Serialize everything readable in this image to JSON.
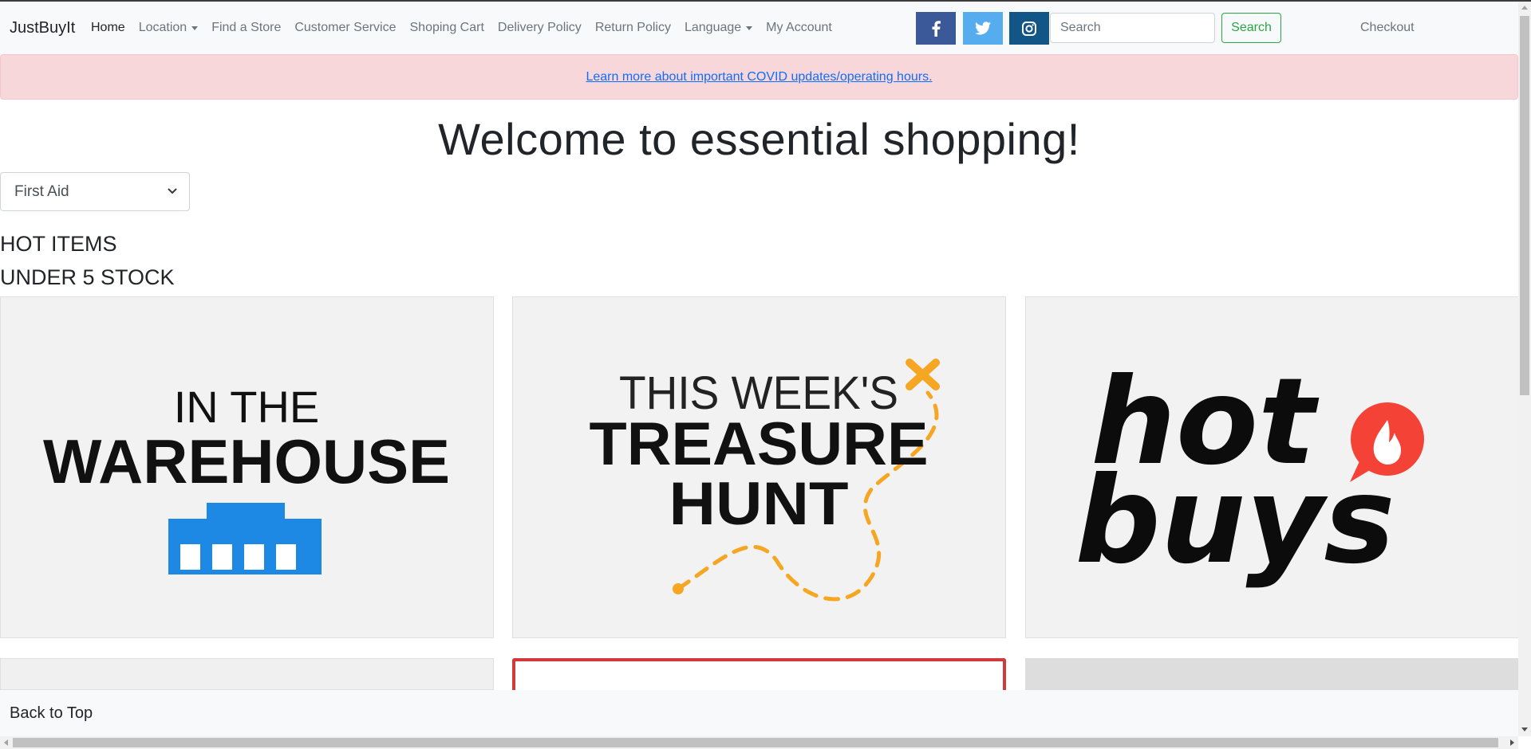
{
  "navbar": {
    "brand": "JustBuyIt",
    "links": [
      {
        "label": "Home",
        "active": true
      },
      {
        "label": "Location",
        "dropdown": true
      },
      {
        "label": "Find a Store"
      },
      {
        "label": "Customer Service"
      },
      {
        "label": "Shoping Cart"
      },
      {
        "label": "Delivery Policy"
      },
      {
        "label": "Return Policy"
      },
      {
        "label": "Language",
        "dropdown": true
      },
      {
        "label": "My Account"
      }
    ],
    "social": {
      "facebook_icon": "facebook-icon",
      "twitter_icon": "twitter-icon",
      "instagram_icon": "instagram-icon"
    },
    "search_placeholder": "Search",
    "search_button": "Search",
    "checkout": "Checkout"
  },
  "alert": {
    "link_text": "Learn more about important COVID updates/operating hours."
  },
  "page_title": "Welcome to essential shopping!",
  "category_select": {
    "selected": "First Aid"
  },
  "sections": {
    "hot_items": "HOT ITEMS",
    "under_stock": "UNDER 5 STOCK"
  },
  "cards": [
    {
      "line1": "IN THE",
      "line2": "WAREHOUSE"
    },
    {
      "line1": "THIS WEEK'S",
      "line2": "TREASURE",
      "line3": "HUNT"
    },
    {
      "line1": "hot",
      "line2": "buys"
    }
  ],
  "footer": {
    "back_to_top": "Back to Top"
  },
  "colors": {
    "facebook": "#3b5998",
    "twitter": "#55acee",
    "instagram": "#125688",
    "search_button": "#28a745",
    "alert_bg": "#f8d7da",
    "warehouse_blue": "#1e88e5",
    "treasure_orange": "#f5a623",
    "hot_red": "#f44336"
  }
}
